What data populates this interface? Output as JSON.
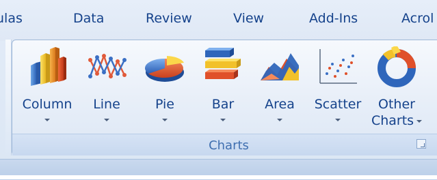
{
  "tabs": [
    {
      "label": "ulas"
    },
    {
      "label": "Data"
    },
    {
      "label": "Review"
    },
    {
      "label": "View"
    },
    {
      "label": "Add-Ins"
    },
    {
      "label": "Acrol"
    }
  ],
  "group": {
    "label": "Charts"
  },
  "buttons": [
    {
      "label": "Column",
      "icon": "column-chart-icon"
    },
    {
      "label": "Line",
      "icon": "line-chart-icon"
    },
    {
      "label": "Pie",
      "icon": "pie-chart-icon"
    },
    {
      "label": "Bar",
      "icon": "bar-chart-icon"
    },
    {
      "label": "Area",
      "icon": "area-chart-icon"
    },
    {
      "label": "Scatter",
      "icon": "scatter-chart-icon"
    },
    {
      "label": "Other",
      "label2": "Charts",
      "icon": "doughnut-chart-icon"
    }
  ],
  "colors": {
    "label_text": "#15428b",
    "group_label_text": "#3f6fb0",
    "panel_border": "#9fb8d8"
  }
}
